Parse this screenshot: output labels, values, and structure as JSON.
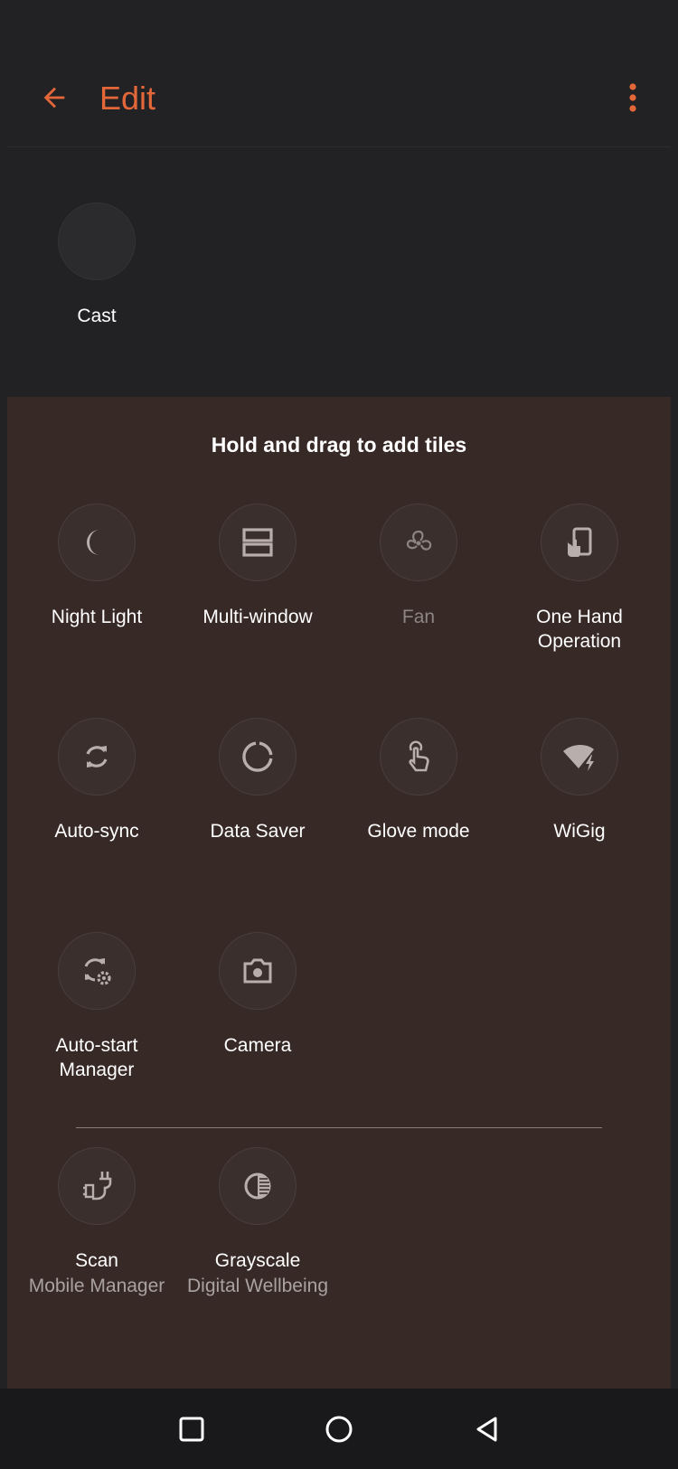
{
  "header": {
    "title": "Edit",
    "accent_color": "#E4673A",
    "back_icon": "arrow-left-icon",
    "more_icon": "more-vertical-icon"
  },
  "active_tiles": [
    {
      "label": "Cast",
      "icon": "blank"
    }
  ],
  "panel": {
    "heading": "Hold and drag to add tiles",
    "tiles": [
      {
        "label": "Night Light",
        "icon": "moon-icon"
      },
      {
        "label": "Multi-window",
        "icon": "multi-window-icon"
      },
      {
        "label": "Fan",
        "icon": "fan-icon",
        "disabled": true
      },
      {
        "label": "One Hand Operation",
        "icon": "one-hand-icon"
      },
      {
        "label": "Auto-sync",
        "icon": "sync-icon"
      },
      {
        "label": "Data Saver",
        "icon": "data-saver-icon"
      },
      {
        "label": "Glove mode",
        "icon": "glove-icon"
      },
      {
        "label": "WiGig",
        "icon": "wigig-icon"
      },
      {
        "label": "Auto-start Manager",
        "icon": "auto-start-icon"
      },
      {
        "label": "Camera",
        "icon": "camera-icon"
      }
    ],
    "app_tiles": [
      {
        "label": "Scan",
        "sublabel": "Mobile Manager",
        "icon": "scan-icon"
      },
      {
        "label": "Grayscale",
        "sublabel": "Digital Wellbeing",
        "icon": "grayscale-icon"
      }
    ]
  },
  "navbar": {
    "recents_icon": "square-icon",
    "home_icon": "circle-icon",
    "back_icon": "triangle-back-icon"
  }
}
